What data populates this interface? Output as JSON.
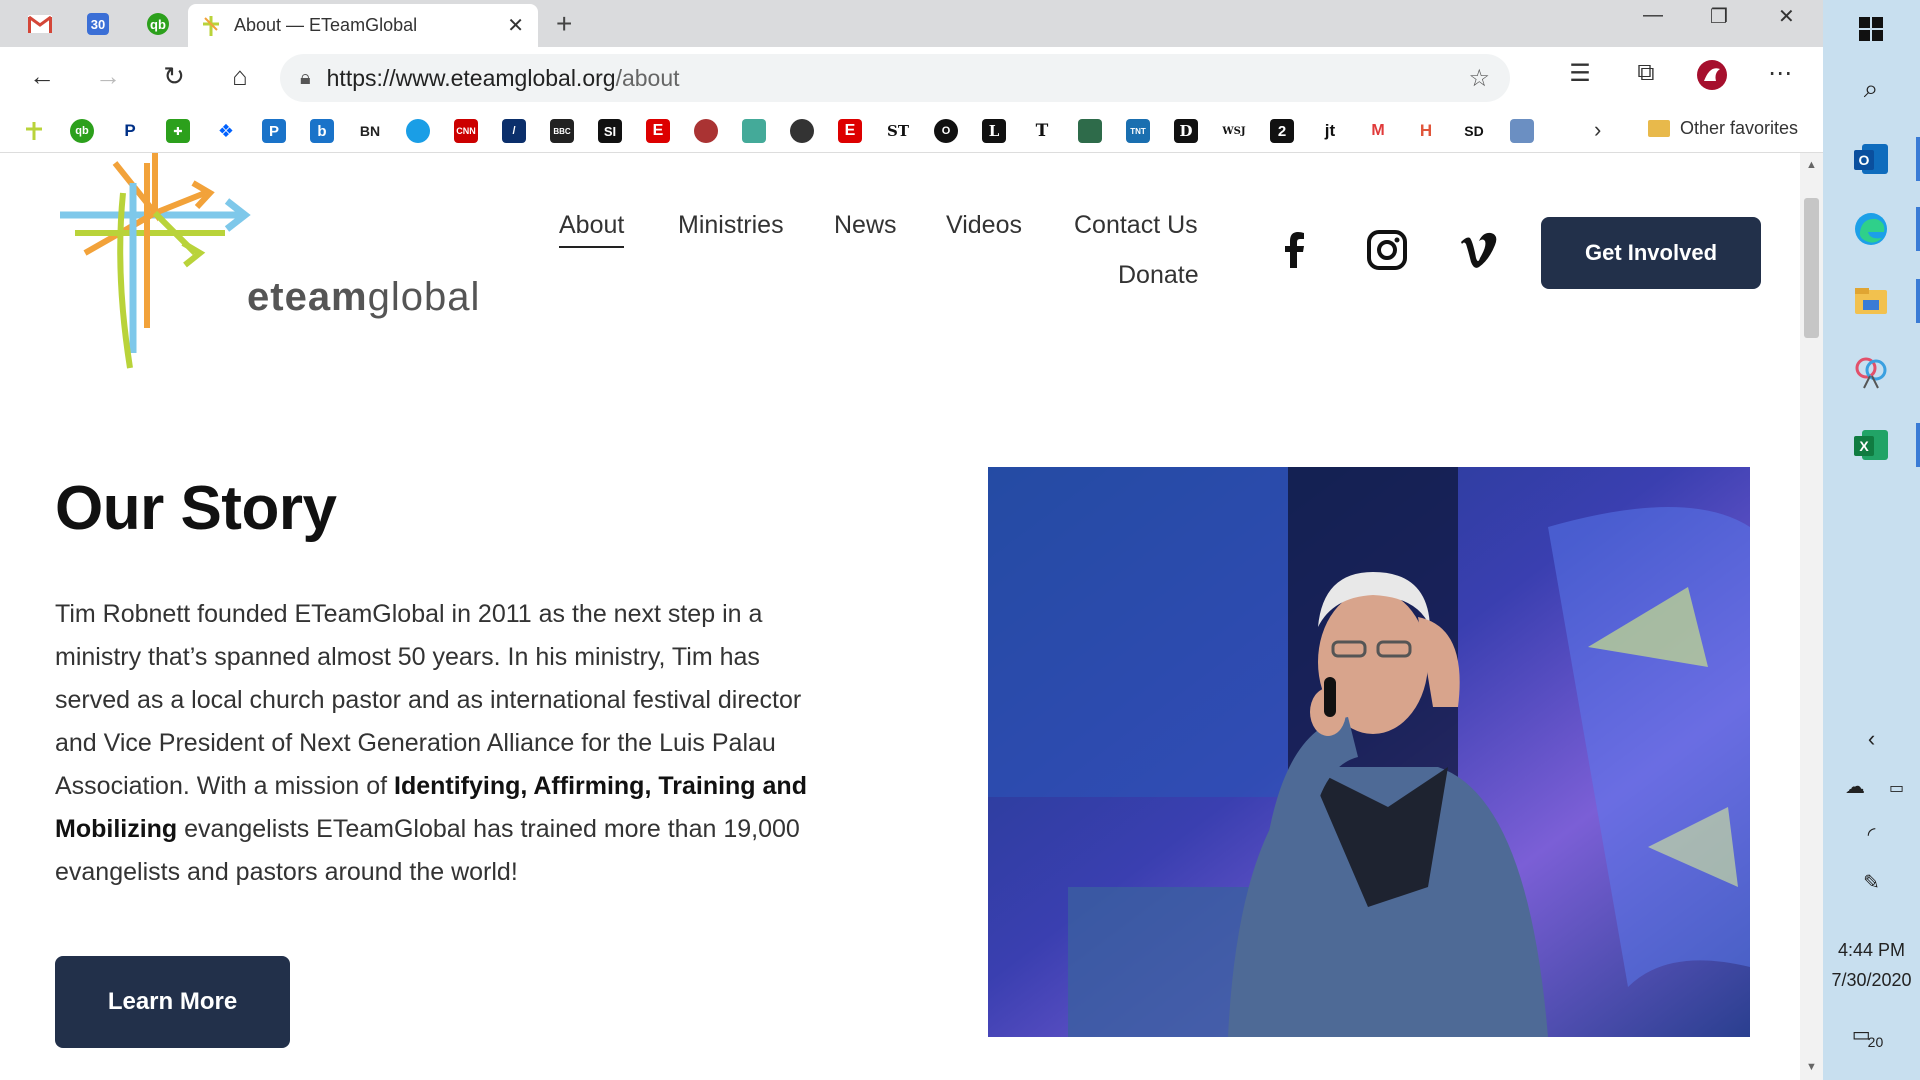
{
  "browser": {
    "active_tab_title": "About — ETeamGlobal",
    "url_domain": "https://www.eteamglobal.org",
    "url_path": "/about",
    "pinned_tab_calendar_day": "30",
    "bookmark_texts": {
      "bn": "BN",
      "si": "SI",
      "wsj": "WSJ",
      "jt": "jt",
      "sd": "SD"
    },
    "other_favorites": "Other favorites"
  },
  "site": {
    "logo": {
      "bold": "eteam",
      "light": "global"
    },
    "nav": {
      "about": "About",
      "ministries": "Ministries",
      "news": "News",
      "videos": "Videos",
      "contact": "Contact Us",
      "donate": "Donate"
    },
    "cta_label": "Get Involved",
    "story": {
      "title": "Our Story",
      "p1": "Tim Robnett founded ETeamGlobal in 2011 as the next step in a ministry that’s spanned almost 50 years. In his ministry, Tim has served as a local church pastor and as international festival director and Vice President of Next Generation Alliance for the Luis Palau Association. With a mission of ",
      "bold": "Identifying, Affirming, Training and Mobilizing",
      "p2": " evangelists ETeamGlobal has trained more than 19,000 evangelists and pastors around the world!",
      "button": "Learn More"
    }
  },
  "taskbar": {
    "time": "4:44 PM",
    "date": "7/30/2020",
    "notifications": "20"
  },
  "colors": {
    "navy": "#22304a",
    "logo_orange": "#f2a23a",
    "logo_blue": "#7ec8ea",
    "logo_green": "#b9d33a"
  }
}
